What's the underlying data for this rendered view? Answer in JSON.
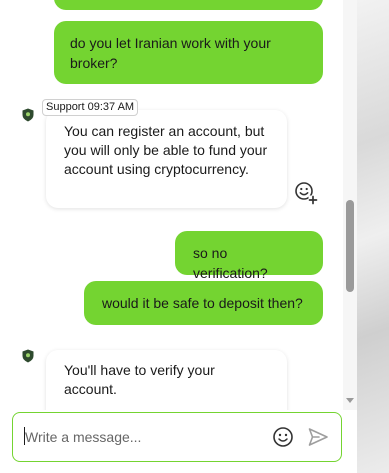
{
  "messages": [
    {
      "from": "user",
      "text": "do you let Iranian work with your broker?"
    },
    {
      "from": "support",
      "author": "Support",
      "time": "09:37 AM",
      "text": "You can register an account, but you will only be able to fund your account using cryptocurrency."
    },
    {
      "from": "user",
      "text": "so no verification?"
    },
    {
      "from": "user",
      "text": "would it be safe to deposit then?"
    },
    {
      "from": "support",
      "text": "You'll have to verify your account."
    }
  ],
  "composer": {
    "placeholder": "Write a message..."
  },
  "icons": {
    "add_reaction": "add-reaction-icon",
    "emoji": "emoji-icon",
    "send": "send-icon",
    "avatar": "shield-avatar-icon"
  },
  "colors": {
    "accent": "#74d431",
    "text": "#1a1a1a",
    "icon": "#333333",
    "send_disabled": "#9e9e9e"
  },
  "scroll": {
    "position_fraction": 0.5
  }
}
